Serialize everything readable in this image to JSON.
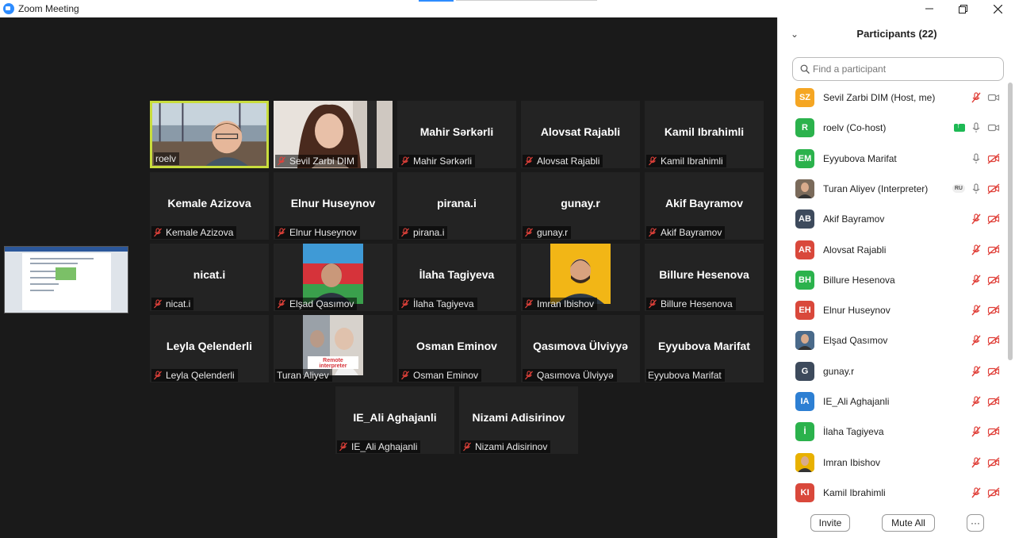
{
  "window": {
    "title": "Zoom Meeting"
  },
  "panel": {
    "title": "Participants (22)",
    "search_placeholder": "Find a participant",
    "invite_label": "Invite",
    "mute_all_label": "Mute All",
    "more_label": "···"
  },
  "tiles": [
    {
      "name": "roelv",
      "label": "roelv",
      "video": "room",
      "speaking": true,
      "muted": false
    },
    {
      "name": "Sevil Zarbi DIM",
      "label": "Sevil Zarbi DIM",
      "video": "woman",
      "muted": true
    },
    {
      "name": "Mahir Sərkərli",
      "label": "Mahir Sərkərli",
      "muted": true
    },
    {
      "name": "Alovsat Rajabli",
      "label": "Alovsat Rajabli",
      "muted": true
    },
    {
      "name": "Kamil Ibrahimli",
      "label": "Kamil Ibrahimli",
      "muted": true
    },
    {
      "name": "Kemale Azizova",
      "label": "Kemale Azizova",
      "muted": true
    },
    {
      "name": "Elnur Huseynov",
      "label": "Elnur Huseynov",
      "muted": true
    },
    {
      "name": "pirana.i",
      "label": "pirana.i",
      "muted": true
    },
    {
      "name": "gunay.r",
      "label": "gunay.r",
      "muted": true
    },
    {
      "name": "Akif Bayramov",
      "label": "Akif Bayramov",
      "muted": true
    },
    {
      "name": "nicat.i",
      "label": "nicat.i",
      "muted": true
    },
    {
      "name": "Elşad Qasımov",
      "label": "Elşad Qasımov",
      "video": "flag",
      "muted": true
    },
    {
      "name": "İlaha Tagiyeva",
      "label": "İlaha Tagiyeva",
      "muted": true
    },
    {
      "name": "Imran Ibishov",
      "label": "Imran Ibishov",
      "video": "yellow",
      "muted": true
    },
    {
      "name": "Billure Hesenova",
      "label": "Billure Hesenova",
      "muted": true
    },
    {
      "name": "Leyla Qelenderli",
      "label": "Leyla Qelenderli",
      "muted": true
    },
    {
      "name": "Turan Aliyev",
      "label": "Turan Aliyev",
      "video": "interp",
      "muted": false
    },
    {
      "name": "Osman Eminov",
      "label": "Osman Eminov",
      "muted": true
    },
    {
      "name": "Qasımova Ülviyyə",
      "label": "Qasımova Ülviyyə",
      "muted": true
    },
    {
      "name": "Eyyubova Marifat",
      "label": "Eyyubova Marifat",
      "muted": false
    },
    {
      "name": "IE_Ali Aghajanli",
      "label": "IE_Ali Aghajanli",
      "muted": true
    },
    {
      "name": "Nizami Adisirinov",
      "label": "Nizami Adisirinov",
      "muted": true
    }
  ],
  "participants": [
    {
      "initials": "SZ",
      "name": "Sevil Zarbi DIM (Host, me)",
      "color": "#f5a623",
      "mic": "muted",
      "video": "on"
    },
    {
      "initials": "R",
      "name": "roelv (Co-host)",
      "color": "#2bb24c",
      "mic": "on",
      "video": "on",
      "sharing": true
    },
    {
      "initials": "EM",
      "name": "Eyyubova Marifat",
      "color": "#2bb24c",
      "mic": "on",
      "video": "off"
    },
    {
      "initials": "",
      "name": "Turan Aliyev (Interpreter)",
      "color": "#7a6a5a",
      "mic": "on",
      "video": "off",
      "badge": "RU",
      "photo": true
    },
    {
      "initials": "AB",
      "name": "Akif Bayramov",
      "color": "#3d4a5c",
      "mic": "muted",
      "video": "off"
    },
    {
      "initials": "AR",
      "name": "Alovsat Rajabli",
      "color": "#d9483b",
      "mic": "muted",
      "video": "off"
    },
    {
      "initials": "BH",
      "name": "Billure Hesenova",
      "color": "#2bb24c",
      "mic": "muted",
      "video": "off"
    },
    {
      "initials": "EH",
      "name": "Elnur Huseynov",
      "color": "#d9483b",
      "mic": "muted",
      "video": "off"
    },
    {
      "initials": "",
      "name": "Elşad Qasımov",
      "color": "#4a6a8a",
      "mic": "muted",
      "video": "off",
      "photo": true
    },
    {
      "initials": "G",
      "name": "gunay.r",
      "color": "#3d4a5c",
      "mic": "muted",
      "video": "off"
    },
    {
      "initials": "IA",
      "name": "IE_Ali Aghajanli",
      "color": "#2d7fd3",
      "mic": "muted",
      "video": "off"
    },
    {
      "initials": "İ",
      "name": "İlaha Tagiyeva",
      "color": "#2bb24c",
      "mic": "muted",
      "video": "off"
    },
    {
      "initials": "",
      "name": "Imran Ibishov",
      "color": "#e8b100",
      "mic": "muted",
      "video": "off",
      "photo": true
    },
    {
      "initials": "KI",
      "name": "Kamil Ibrahimli",
      "color": "#d9483b",
      "mic": "muted",
      "video": "off"
    }
  ],
  "colors": {
    "speaking_border": "#c9dd3d",
    "muted_red": "#e0413a",
    "accent": "#2d8cff"
  }
}
